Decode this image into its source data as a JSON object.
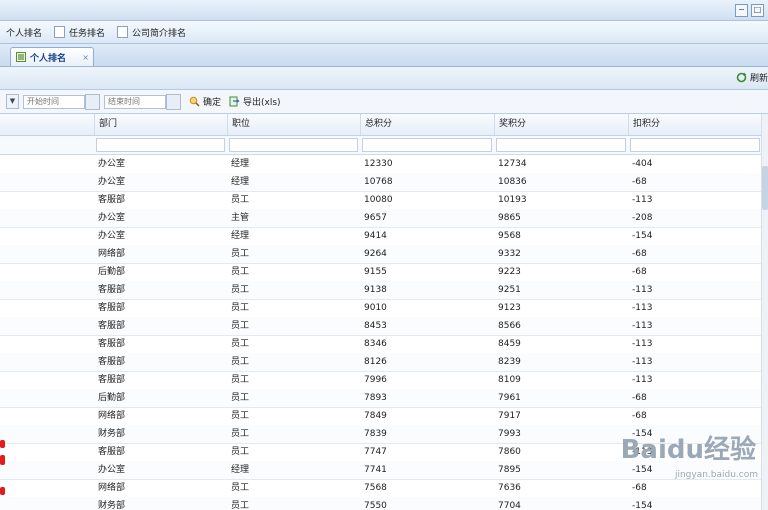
{
  "menu": {
    "items": [
      {
        "label": "个人排名",
        "icon": "list-icon"
      },
      {
        "label": "任务排名",
        "icon": "doc-icon"
      },
      {
        "label": "公司简介排名",
        "icon": "doc-icon"
      }
    ]
  },
  "tabs": [
    {
      "label": "个人排名",
      "icon": "tab-list-icon",
      "close": "×"
    }
  ],
  "strip": {
    "refresh_label": "刷新"
  },
  "toolbar": {
    "start_placeholder": "开始时间",
    "end_placeholder": "结束时间",
    "confirm_label": "确定",
    "export_label": "导出(xls)"
  },
  "grid": {
    "columns": [
      "部门",
      "职位",
      "总积分",
      "奖积分",
      "扣积分"
    ],
    "rows": [
      [
        "办公室",
        "经理",
        "12330",
        "12734",
        "-404"
      ],
      [
        "办公室",
        "经理",
        "10768",
        "10836",
        "-68"
      ],
      [
        "客服部",
        "员工",
        "10080",
        "10193",
        "-113"
      ],
      [
        "办公室",
        "主管",
        "9657",
        "9865",
        "-208"
      ],
      [
        "办公室",
        "经理",
        "9414",
        "9568",
        "-154"
      ],
      [
        "网络部",
        "员工",
        "9264",
        "9332",
        "-68"
      ],
      [
        "后勤部",
        "员工",
        "9155",
        "9223",
        "-68"
      ],
      [
        "客服部",
        "员工",
        "9138",
        "9251",
        "-113"
      ],
      [
        "客服部",
        "员工",
        "9010",
        "9123",
        "-113"
      ],
      [
        "客服部",
        "员工",
        "8453",
        "8566",
        "-113"
      ],
      [
        "客服部",
        "员工",
        "8346",
        "8459",
        "-113"
      ],
      [
        "客服部",
        "员工",
        "8126",
        "8239",
        "-113"
      ],
      [
        "客服部",
        "员工",
        "7996",
        "8109",
        "-113"
      ],
      [
        "后勤部",
        "员工",
        "7893",
        "7961",
        "-68"
      ],
      [
        "网络部",
        "员工",
        "7849",
        "7917",
        "-68"
      ],
      [
        "财务部",
        "员工",
        "7839",
        "7993",
        "-154"
      ],
      [
        "客服部",
        "员工",
        "7747",
        "7860",
        "-113"
      ],
      [
        "办公室",
        "经理",
        "7741",
        "7895",
        "-154"
      ],
      [
        "网络部",
        "员工",
        "7568",
        "7636",
        "-68"
      ],
      [
        "财务部",
        "员工",
        "7550",
        "7704",
        "-154"
      ]
    ]
  },
  "watermark": {
    "text": "Baidu经验",
    "sub": "jingyan.baidu.com"
  }
}
